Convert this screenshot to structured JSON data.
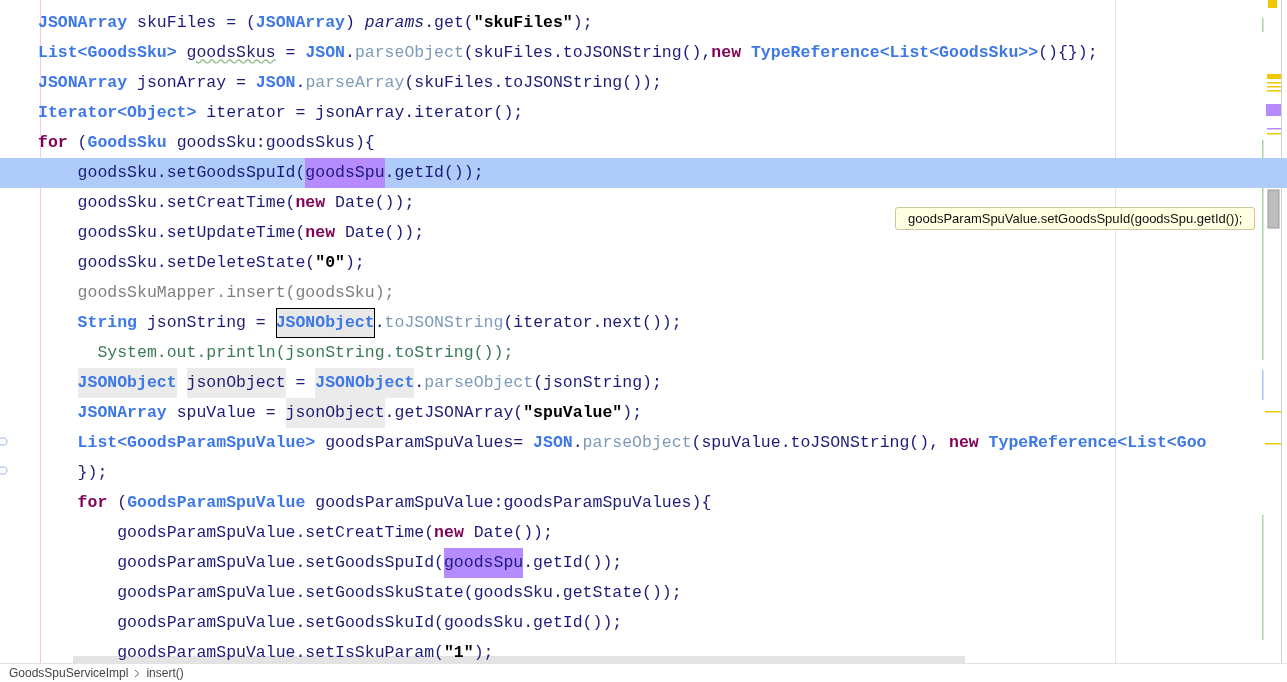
{
  "editor": {
    "lines": [
      {
        "highlighted": false,
        "tokens": [
          {
            "kind": "type",
            "text": "JSONArray"
          },
          {
            "kind": "plain",
            "text": " skuFiles = ("
          },
          {
            "kind": "type",
            "text": "JSONArray"
          },
          {
            "kind": "plain",
            "text": ") "
          },
          {
            "kind": "italic",
            "text": "params"
          },
          {
            "kind": "plain",
            "text": ".get("
          },
          {
            "kind": "string",
            "text": "\"skuFiles\""
          },
          {
            "kind": "plain",
            "text": ");"
          }
        ]
      },
      {
        "highlighted": false,
        "tokens": [
          {
            "kind": "type",
            "text": "List<GoodsSku> "
          },
          {
            "kind": "plain",
            "text": "goodsSkus",
            "typo": true
          },
          {
            "kind": "plain",
            "text": " = "
          },
          {
            "kind": "type",
            "text": "JSON"
          },
          {
            "kind": "plain",
            "text": "."
          },
          {
            "kind": "static",
            "text": "parseObject"
          },
          {
            "kind": "plain",
            "text": "(skuFiles.toJSONString(),"
          },
          {
            "kind": "keyword",
            "text": "new "
          },
          {
            "kind": "type",
            "text": "TypeReference<List<GoodsSku>>"
          },
          {
            "kind": "plain",
            "text": "(){});"
          }
        ]
      },
      {
        "highlighted": false,
        "tokens": [
          {
            "kind": "type",
            "text": "JSONArray"
          },
          {
            "kind": "plain",
            "text": " jsonArray = "
          },
          {
            "kind": "type",
            "text": "JSON"
          },
          {
            "kind": "plain",
            "text": "."
          },
          {
            "kind": "static",
            "text": "parseArray"
          },
          {
            "kind": "plain",
            "text": "(skuFiles.toJSONString());"
          }
        ]
      },
      {
        "highlighted": false,
        "tokens": [
          {
            "kind": "type",
            "text": "Iterator<Object>"
          },
          {
            "kind": "plain",
            "text": " iterator = jsonArray.iterator();"
          }
        ]
      },
      {
        "highlighted": false,
        "tokens": [
          {
            "kind": "keyword",
            "text": "for"
          },
          {
            "kind": "plain",
            "text": " ("
          },
          {
            "kind": "type",
            "text": "GoodsSku"
          },
          {
            "kind": "plain",
            "text": " goodsSku:goodsSkus){"
          }
        ]
      },
      {
        "highlighted": true,
        "tokens": [
          {
            "kind": "plain",
            "text": "    goodsSku.setGoodsSpuId("
          },
          {
            "kind": "plain",
            "text": "goodsSpu",
            "occurrence": true
          },
          {
            "kind": "plain",
            "text": ".getId());"
          }
        ]
      },
      {
        "highlighted": false,
        "tokens": [
          {
            "kind": "plain",
            "text": "    goodsSku.setCreatTime("
          },
          {
            "kind": "keyword",
            "text": "new"
          },
          {
            "kind": "plain",
            "text": " Date());"
          }
        ]
      },
      {
        "highlighted": false,
        "tokens": [
          {
            "kind": "plain",
            "text": "    goodsSku.setUpdateTime("
          },
          {
            "kind": "keyword",
            "text": "new"
          },
          {
            "kind": "plain",
            "text": " Date());"
          }
        ]
      },
      {
        "highlighted": false,
        "tokens": [
          {
            "kind": "plain",
            "text": "    goodsSku.setDeleteState("
          },
          {
            "kind": "string",
            "text": "\"0\""
          },
          {
            "kind": "plain",
            "text": ");"
          }
        ]
      },
      {
        "highlighted": false,
        "tokens": [
          {
            "kind": "unused",
            "text": "    goodsSkuMapper.insert(goodsSku);"
          }
        ]
      },
      {
        "highlighted": false,
        "tokens": [
          {
            "kind": "type",
            "text": "    String"
          },
          {
            "kind": "plain",
            "text": " jsonString = "
          },
          {
            "kind": "type",
            "text": "JSONObject",
            "boxed": true
          },
          {
            "kind": "plain",
            "text": "."
          },
          {
            "kind": "static",
            "text": "toJSONString"
          },
          {
            "kind": "plain",
            "text": "(iterator.next());"
          }
        ]
      },
      {
        "highlighted": false,
        "tokens": [
          {
            "kind": "output",
            "text": "      System.out.println(jsonString.toString());"
          }
        ]
      },
      {
        "highlighted": false,
        "tokens": [
          {
            "kind": "type",
            "text": "    JSONObject",
            "usage": true
          },
          {
            "kind": "plain",
            "text": " jsonObject",
            "usage": true
          },
          {
            "kind": "plain",
            "text": " = "
          },
          {
            "kind": "type",
            "text": "JSONObject",
            "usage": true
          },
          {
            "kind": "plain",
            "text": "."
          },
          {
            "kind": "static",
            "text": "parseObject"
          },
          {
            "kind": "plain",
            "text": "(jsonString);"
          }
        ]
      },
      {
        "highlighted": false,
        "tokens": [
          {
            "kind": "type",
            "text": "    JSONArray"
          },
          {
            "kind": "plain",
            "text": " spuValue = "
          },
          {
            "kind": "plain",
            "text": "jsonObject",
            "usage": true
          },
          {
            "kind": "plain",
            "text": ".getJSONArray("
          },
          {
            "kind": "string",
            "text": "\"spuValue\""
          },
          {
            "kind": "plain",
            "text": ");"
          }
        ]
      },
      {
        "highlighted": false,
        "tokens": [
          {
            "kind": "type",
            "text": "    List<GoodsParamSpuValue>"
          },
          {
            "kind": "plain",
            "text": " goodsParamSpuValues= "
          },
          {
            "kind": "type",
            "text": "JSON"
          },
          {
            "kind": "plain",
            "text": "."
          },
          {
            "kind": "static",
            "text": "parseObject"
          },
          {
            "kind": "plain",
            "text": "(spuValue.toJSONString(), "
          },
          {
            "kind": "keyword",
            "text": "new "
          },
          {
            "kind": "type",
            "text": "TypeReference<List<Goo"
          }
        ]
      },
      {
        "highlighted": false,
        "tokens": [
          {
            "kind": "plain",
            "text": "    });"
          }
        ]
      },
      {
        "highlighted": false,
        "tokens": [
          {
            "kind": "keyword",
            "text": "    for"
          },
          {
            "kind": "plain",
            "text": " ("
          },
          {
            "kind": "type",
            "text": "GoodsParamSpuValue"
          },
          {
            "kind": "plain",
            "text": " goodsParamSpuValue:goodsParamSpuValues){"
          }
        ]
      },
      {
        "highlighted": false,
        "tokens": [
          {
            "kind": "plain",
            "text": "        goodsParamSpuValue.setCreatTime("
          },
          {
            "kind": "keyword",
            "text": "new"
          },
          {
            "kind": "plain",
            "text": " Date());"
          }
        ]
      },
      {
        "highlighted": false,
        "tokens": [
          {
            "kind": "plain",
            "text": "        goodsParamSpuValue.setGoodsSpuId("
          },
          {
            "kind": "plain",
            "text": "goodsSpu",
            "occurrence": true
          },
          {
            "kind": "plain",
            "text": ".getId());"
          }
        ]
      },
      {
        "highlighted": false,
        "tokens": [
          {
            "kind": "plain",
            "text": "        goodsParamSpuValue.setGoodsSkuState(goodsSku.getState());"
          }
        ]
      },
      {
        "highlighted": false,
        "tokens": [
          {
            "kind": "plain",
            "text": "        goodsParamSpuValue.setGoodsSkuId(goodsSku.getId());"
          }
        ]
      },
      {
        "highlighted": false,
        "tokens": [
          {
            "kind": "plain",
            "text": "        goodsParamSpuValue.setIsSkuParam("
          },
          {
            "kind": "string",
            "text": "\"1\""
          },
          {
            "kind": "plain",
            "text": ");"
          }
        ]
      }
    ]
  },
  "tooltip": {
    "text": "goodsParamSpuValue.setGoodsSpuId(goodsSpu.getId());"
  },
  "breadcrumbs": [
    "GoodsSpuServiceImpl",
    "insert()"
  ]
}
